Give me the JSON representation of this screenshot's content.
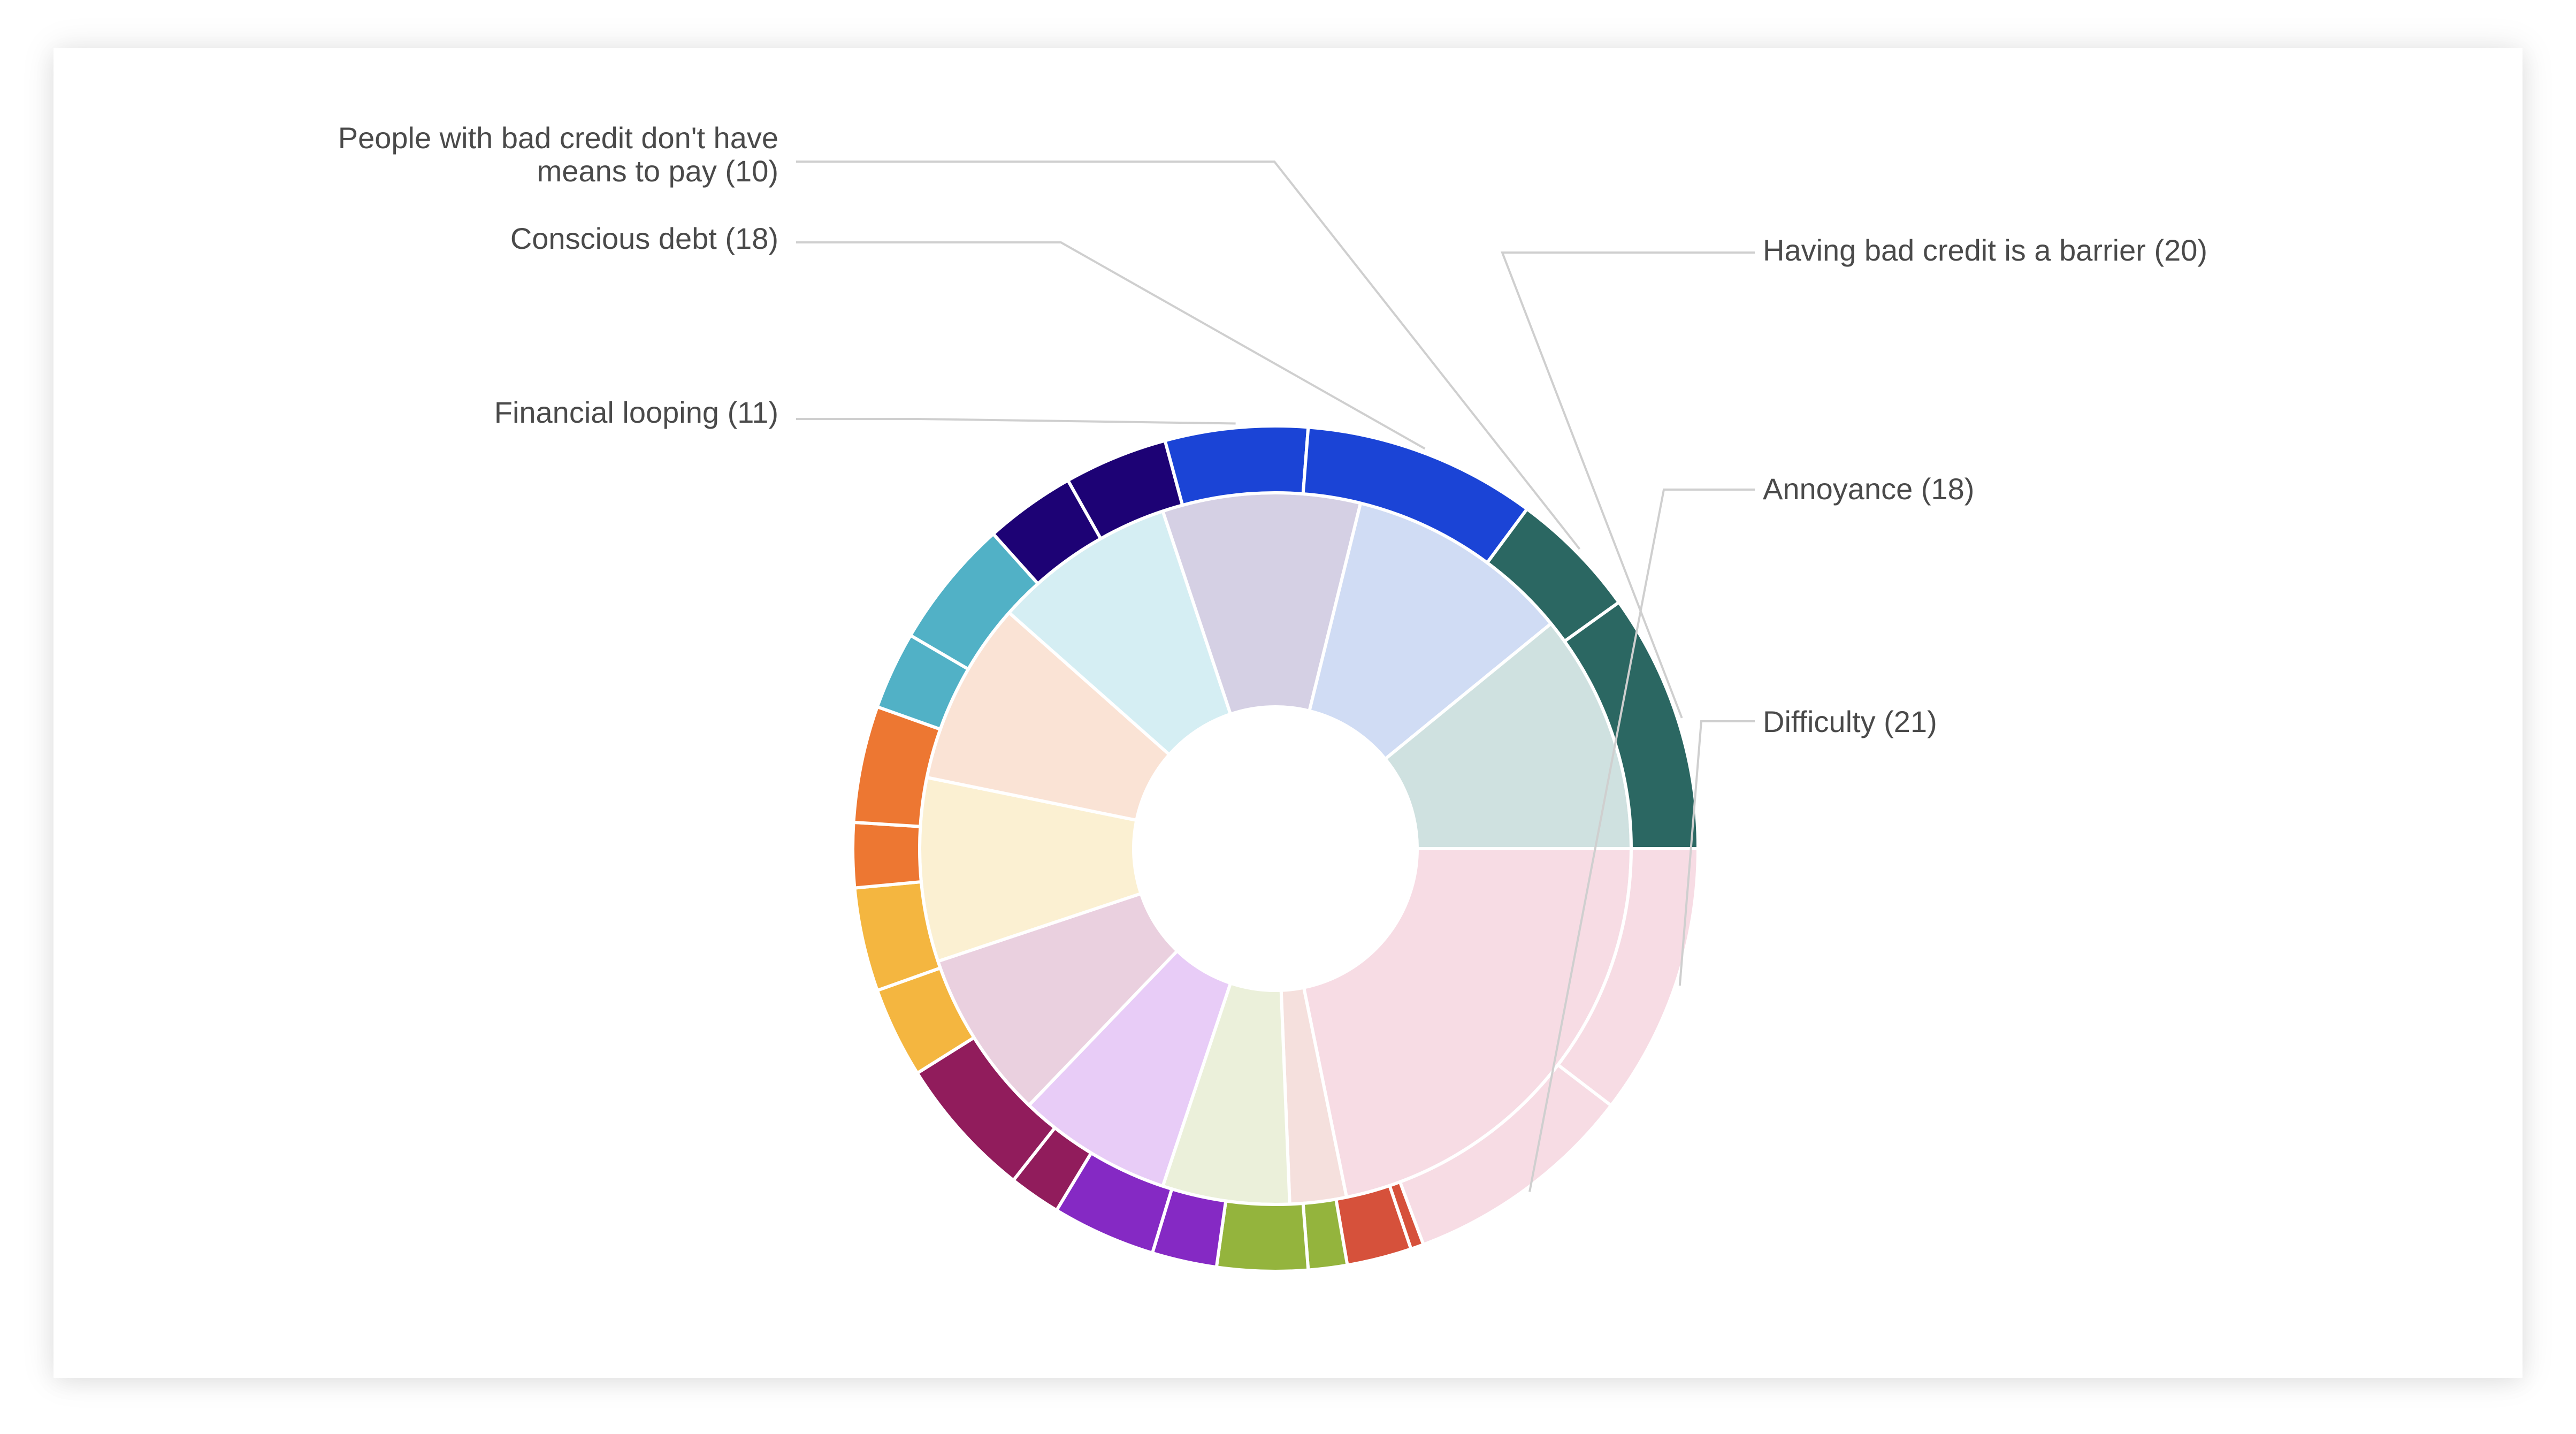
{
  "chart_data": {
    "type": "sunburst",
    "inner": [
      {
        "name": "",
        "value": 34,
        "color": "#f7dce4"
      },
      {
        "name": "",
        "value": 4,
        "color": "#f5e0dd"
      },
      {
        "name": "",
        "value": 9,
        "color": "#ebf0da"
      },
      {
        "name": "",
        "value": 11,
        "color": "#e8ccf7"
      },
      {
        "name": "",
        "value": 12,
        "color": "#ead0df"
      },
      {
        "name": "",
        "value": 13,
        "color": "#fbf0d2"
      },
      {
        "name": "",
        "value": 13,
        "color": "#fae3d5"
      },
      {
        "name": "",
        "value": 13,
        "color": "#d5eef3"
      },
      {
        "name": "",
        "value": 14,
        "color": "#d5d0e4"
      },
      {
        "name": "",
        "value": 16,
        "color": "#d0dcf4"
      },
      {
        "name": "",
        "value": 17,
        "color": "#cfe1e0"
      }
    ],
    "outer": [
      {
        "name": "Difficulty",
        "value": 21,
        "color": "#f7dce4",
        "label": "Difficulty (21)"
      },
      {
        "name": "Annoyance",
        "value": 18,
        "color": "#f7dce4",
        "label": "Annoyance (18)"
      },
      {
        "name": "",
        "value": 1,
        "color": "#d6513b"
      },
      {
        "name": "",
        "value": 5,
        "color": "#d6513b"
      },
      {
        "name": "",
        "value": 3,
        "color": "#94b43d"
      },
      {
        "name": "",
        "value": 7,
        "color": "#94b43d"
      },
      {
        "name": "",
        "value": 5,
        "color": "#8529c4"
      },
      {
        "name": "",
        "value": 8,
        "color": "#8529c4"
      },
      {
        "name": "",
        "value": 4,
        "color": "#911c5c"
      },
      {
        "name": "",
        "value": 11,
        "color": "#911c5c"
      },
      {
        "name": "",
        "value": 7,
        "color": "#f4b640"
      },
      {
        "name": "",
        "value": 8,
        "color": "#f4b640"
      },
      {
        "name": "",
        "value": 5,
        "color": "#ed7732"
      },
      {
        "name": "",
        "value": 9,
        "color": "#ed7732"
      },
      {
        "name": "",
        "value": 6,
        "color": "#51b1c6"
      },
      {
        "name": "",
        "value": 10,
        "color": "#51b1c6"
      },
      {
        "name": "",
        "value": 7,
        "color": "#1d0275"
      },
      {
        "name": "",
        "value": 8,
        "color": "#1d0275"
      },
      {
        "name": "Financial looping",
        "value": 11,
        "color": "#1b44d6",
        "label": "Financial looping (11)"
      },
      {
        "name": "Conscious debt",
        "value": 18,
        "color": "#1b44d6",
        "label": "Conscious debt (18)"
      },
      {
        "name": "People with bad credit don't have means to pay",
        "value": 10,
        "color": "#2b6762",
        "label": "People with bad credit don't have means to pay (10)"
      },
      {
        "name": "Having bad credit is a barrier",
        "value": 20,
        "color": "#2b6762",
        "label": "Having bad credit is a barrier (20)"
      }
    ],
    "labels": [
      {
        "outer_index": 21,
        "text": [
          "Having bad credit is a barrier (20)"
        ]
      },
      {
        "outer_index": 1,
        "text": [
          "Annoyance (18)"
        ]
      },
      {
        "outer_index": 0,
        "text": [
          "Difficulty (21)"
        ]
      },
      {
        "outer_index": 20,
        "text": [
          "People with bad credit don't have",
          "means to pay (10)"
        ]
      },
      {
        "outer_index": 19,
        "text": [
          "Conscious debt (18)"
        ]
      },
      {
        "outer_index": 18,
        "text": [
          "Financial looping (11)"
        ]
      }
    ]
  }
}
